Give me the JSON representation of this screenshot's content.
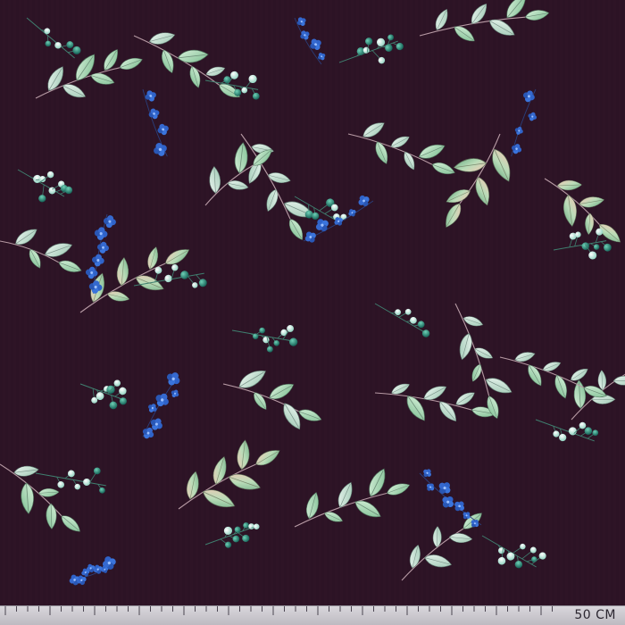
{
  "image": {
    "subject": "printed-fabric",
    "background_color": "#2e1426",
    "leaf_colors": [
      "#a8d8b0",
      "#cfe9d2",
      "#7fbf93",
      "#e8b9a5"
    ],
    "berry_colors": [
      "#dff3ea",
      "#1f7a6a",
      "#4fb7a0"
    ],
    "blossom_color": "#2f63c9",
    "stem_color": "#b79aa4"
  },
  "ruler": {
    "label": "50 CM",
    "background_color": "#cfcdd3"
  }
}
